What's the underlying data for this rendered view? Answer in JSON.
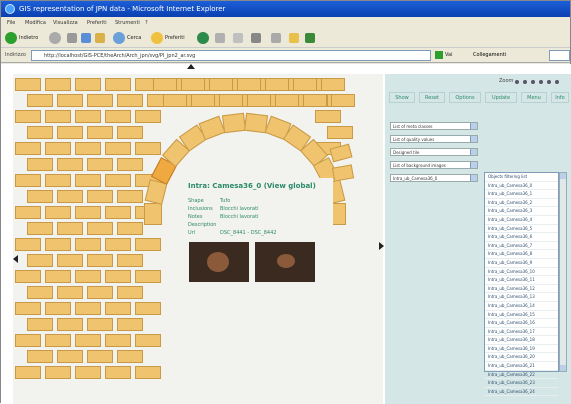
{
  "window": {
    "title": "GIS representation of JPN data - Microsoft Internet Explorer"
  },
  "menu": [
    "File",
    "Modifica",
    "Visualizza",
    "Preferiti",
    "Strumenti",
    "?"
  ],
  "toolbar": {
    "back": "Indietro",
    "search": "Cerca",
    "favorites": "Preferiti"
  },
  "address": {
    "label": "Indirizzo",
    "url": "http://localhost/GIS-PCE/theArch/Arch_jpn/svg/PI_jpn2_ar.svg",
    "go": "Vai",
    "links": "Collegamenti"
  },
  "zoom": {
    "label": "Zoom"
  },
  "tabs": [
    "Show",
    "Reset",
    "Options",
    "Update",
    "Menu",
    "Info"
  ],
  "dropdowns": [
    "List of meta classes",
    "List of quality values",
    "Designed tile",
    "List of background images",
    "Intra_ub_Camesa36_0"
  ],
  "listbox": [
    "Objects filtering list",
    "Intra_ub_Camesa36_0",
    "Intra_ub_Camesa36_1",
    "Intra_ub_Camesa36_2",
    "Intra_ub_Camesa36_3",
    "Intra_ub_Camesa36_4",
    "Intra_ub_Camesa36_5",
    "Intra_ub_Camesa36_6",
    "Intra_ub_Camesa36_7",
    "Intra_ub_Camesa36_8",
    "Intra_ub_Camesa36_9",
    "Intra_ub_Camesa36_10",
    "Intra_ub_Camesa36_11",
    "Intra_ub_Camesa36_12",
    "Intra_ub_Camesa36_13",
    "Intra_ub_Camesa36_14",
    "Intra_ub_Camesa36_15",
    "Intra_ub_Camesa36_16",
    "Intra_ub_Camesa36_17",
    "Intra_ub_Camesa36_18",
    "Intra_ub_Camesa36_19",
    "Intra_ub_Camesa36_20",
    "Intra_ub_Camesa36_21",
    "Intra_ub_Camesa36_22",
    "Intra_ub_Camesa36_23",
    "Intra_ub_Camesa36_24"
  ],
  "info": {
    "title": "Intra: Camesa36_0 (View global)",
    "rows": [
      {
        "key": "Shape",
        "value": "Tufo"
      },
      {
        "key": "Inclusions",
        "value": "Blocchi lavorati"
      },
      {
        "key": "Notes",
        "value": "Blocchi lavorati"
      },
      {
        "key": "Description",
        "value": ""
      },
      {
        "key": "Url",
        "value": "DSC_8441 - DSC_8442"
      }
    ]
  },
  "colors": {
    "stone": "#f0c36e",
    "stone_selected": "#f0a840",
    "panel": "#d5e6e6",
    "title_bar": "#0a3fb0"
  }
}
